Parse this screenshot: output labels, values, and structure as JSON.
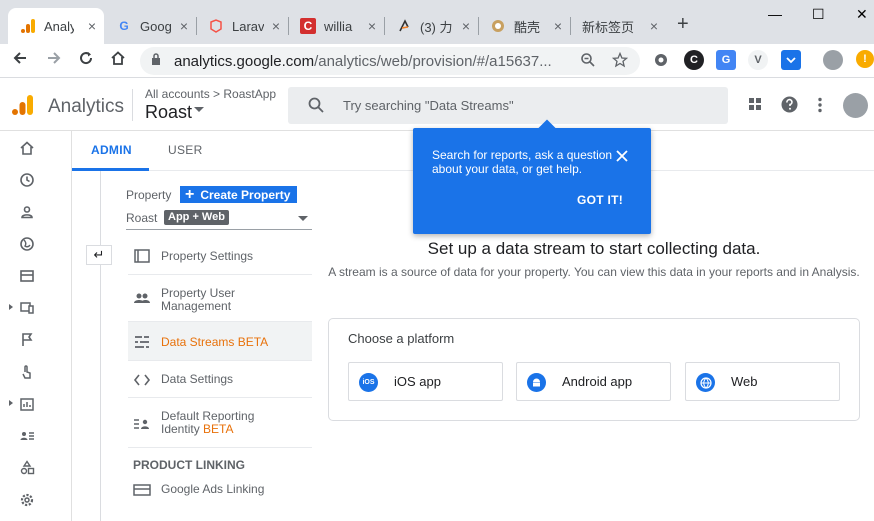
{
  "browser": {
    "tabs": [
      {
        "title": "Analy",
        "favicon": "analytics-icon",
        "active": true
      },
      {
        "title": "Goog",
        "favicon": "google-icon"
      },
      {
        "title": "Larav",
        "favicon": "laravel-icon"
      },
      {
        "title": "willia",
        "favicon": "c-red-icon"
      },
      {
        "title": "(3) 力",
        "favicon": "brand-icon"
      },
      {
        "title": "酷壳",
        "favicon": "coolshell-icon"
      },
      {
        "title": "新标签页",
        "favicon": ""
      }
    ],
    "close_glyph": "×",
    "new_tab_glyph": "+",
    "window_controls": {
      "minimize": "—",
      "maximize": "☐",
      "close": "✕"
    },
    "url_host": "analytics.google.com",
    "url_path": "/analytics/web/provision/#/a15637...",
    "accent": "#1a73e8"
  },
  "ga": {
    "product": "Analytics",
    "breadcrumb": "All accounts > RoastApp",
    "property": "Roast",
    "search_placeholder": "Try searching \"Data Streams\""
  },
  "admin_tabs": {
    "admin": "ADMIN",
    "user": "USER"
  },
  "property_panel": {
    "label": "Property",
    "create_button": "Create Property",
    "property_name": "Roast",
    "property_type": "App + Web",
    "back_glyph": "↵"
  },
  "menu": [
    {
      "label": "Property Settings"
    },
    {
      "label": "Property User Management"
    },
    {
      "label": "Data Streams BETA"
    },
    {
      "label": "Data Settings"
    },
    {
      "label": "Default Reporting Identity",
      "beta": "BETA"
    },
    {
      "label": "Google Ads Linking"
    }
  ],
  "product_linking": "PRODUCT LINKING",
  "main": {
    "title": "Set up a data stream to start collecting data.",
    "description": "A stream is a source of data for your property. You can view this data in your reports and in Analysis.",
    "choose_platform": "Choose a platform",
    "platforms": [
      {
        "label": "iOS app",
        "icon_text": "iOS"
      },
      {
        "label": "Android app"
      },
      {
        "label": "Web"
      }
    ]
  },
  "tooltip": {
    "message": "Search for reports, ask a question about your data, or get help.",
    "action": "GOT IT!"
  }
}
